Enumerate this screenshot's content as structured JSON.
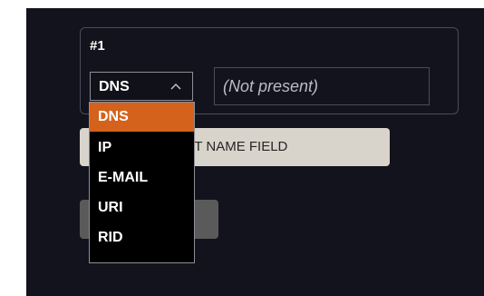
{
  "entry": {
    "index_label": "#1",
    "type_select": {
      "value": "DNS",
      "options": [
        "DNS",
        "IP",
        "E-MAIL",
        "URI",
        "RID"
      ],
      "highlighted_option": "DNS"
    },
    "value_field": {
      "text": "(Not present)"
    }
  },
  "select_alt_name_button": {
    "visible_label": "CT ALT NAME FIELD"
  },
  "second_button": {
    "visible_label": ""
  },
  "colors": {
    "background": "#13131d",
    "highlight": "#d4621c",
    "button": "#d9d4cb",
    "disabled_button": "#5a5a5a"
  }
}
